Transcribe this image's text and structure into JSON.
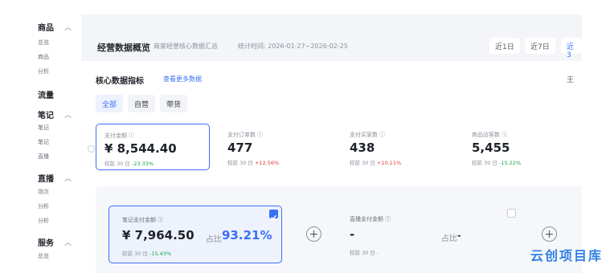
{
  "sidebar": {
    "groups": [
      {
        "label": "商品",
        "items": [
          "总览",
          "商品",
          "分析"
        ]
      },
      {
        "label": "流量",
        "items": []
      },
      {
        "label": "直播",
        "items": [
          "场次",
          "分析",
          "分析"
        ]
      },
      {
        "label": "服务",
        "items": [
          "总览"
        ]
      }
    ],
    "notes": {
      "label": "笔记",
      "items": [
        "笔记",
        "笔记",
        "直播"
      ]
    }
  },
  "header": {
    "title": "经营数据概览",
    "subtitle": "商家经营核心数据汇总",
    "range_text": "统计时间: 2026-01-27~2026-02-25",
    "range_buttons": [
      "近1日",
      "近7日",
      "近3"
    ]
  },
  "core": {
    "title": "核心数据指标",
    "more_link": "查看更多数据",
    "edge_button": "王",
    "tabs": [
      "全部",
      "自营",
      "带货"
    ],
    "metrics": [
      {
        "label": "支付金额 ⓘ",
        "value": "¥ 8,544.40",
        "compare_prefix": "较前 30 日",
        "delta": "-23.33%",
        "trend": "down",
        "selected": true
      },
      {
        "label": "支付订单数 ⓘ",
        "value": "477",
        "compare_prefix": "较前 30 日",
        "delta": "+12.56%",
        "trend": "up",
        "selected": false
      },
      {
        "label": "支付买家数 ⓘ",
        "value": "438",
        "compare_prefix": "较前 30 日",
        "delta": "+10.11%",
        "trend": "up",
        "selected": false
      },
      {
        "label": "商品访客数 ⓘ",
        "value": "5,455",
        "compare_prefix": "较前 30 日",
        "delta": "-15.22%",
        "trend": "down",
        "selected": false
      }
    ]
  },
  "breakdown": {
    "cards": [
      {
        "label": "笔记支付金额 ⓘ",
        "value": "¥ 7,964.50",
        "share_label": "占比",
        "share": "93.21%",
        "compare_prefix": "较前 30 日",
        "delta": "-15.43%",
        "checked": true
      },
      {
        "label": "直播支付金额 ⓘ",
        "value": "-",
        "share_label": "占比",
        "share": "-",
        "compare_prefix": "较前 30 日",
        "delta": "-",
        "checked": false
      }
    ]
  },
  "watermark": "云创项目库",
  "colors": {
    "accent": "#3a6ff7",
    "down": "#17a34a",
    "up": "#e4393c"
  }
}
